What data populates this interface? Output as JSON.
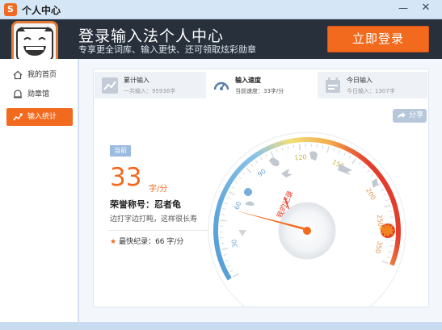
{
  "window": {
    "title": "个人中心",
    "logo_glyph": "S",
    "min_glyph": "—",
    "close_glyph": "✕"
  },
  "banner": {
    "title": "登录输入法个人中心",
    "subtitle": "专享更全词库、输入更快、还可领取炫彩勋章",
    "login_button": "立即登录"
  },
  "sidebar": {
    "items": [
      {
        "label": "我的首页",
        "icon": "home-icon",
        "active": false
      },
      {
        "label": "勋章馆",
        "icon": "medal-icon",
        "active": false
      },
      {
        "label": "输入统计",
        "icon": "chart-icon",
        "active": true
      }
    ]
  },
  "stats": [
    {
      "title": "累计输入",
      "detail": "一共输入：95936字",
      "icon": "trend-chart-icon"
    },
    {
      "title": "输入速度",
      "detail": "当前速度：33字/分",
      "icon": "speedometer-icon"
    },
    {
      "title": "今日输入",
      "detail": "今日输入：1307字",
      "icon": "calendar-icon"
    }
  ],
  "share": {
    "label": "分享"
  },
  "speed": {
    "badge": "当前",
    "value": "33",
    "unit": "字/分",
    "honor": "荣誉称号：忍者龟",
    "honor_desc": "边打字边打盹，这样很长寿",
    "record": "最快纪录：66 字/分"
  },
  "gauge": {
    "ticks": [
      "30",
      "60",
      "90",
      "120",
      "150",
      "200",
      "250",
      "350"
    ],
    "record_label": "我的记录",
    "current_value": 33,
    "colors": {
      "accent": "#f26a1e",
      "bar": "#27303b",
      "blue": "#4f9ad6",
      "yellow": "#f2c84a",
      "red": "#e43c2b"
    }
  }
}
